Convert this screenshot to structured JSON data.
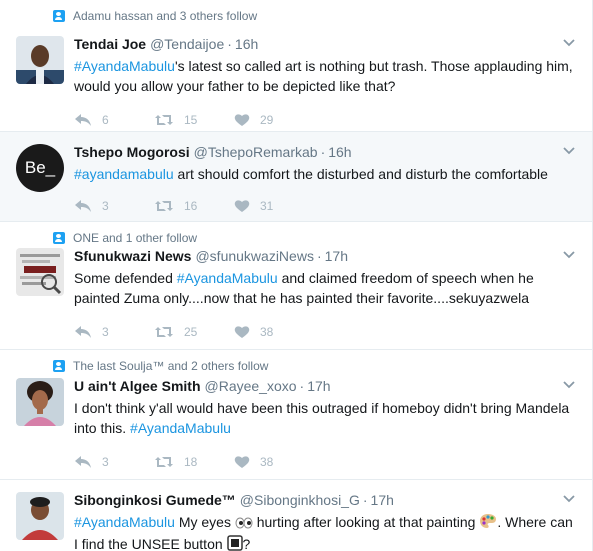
{
  "tweets": [
    {
      "context": "Adamu hassan and 3 others follow",
      "name": "Tendai Joe",
      "handle": "@Tendaijoe",
      "time": "16h",
      "text_pre": "",
      "hashtag": "#AyandaMabulu",
      "text_post": "'s latest so called art is nothing but trash. Those applauding him, would you allow your father to be depicted like that?",
      "replies": "6",
      "retweets": "15",
      "likes": "29"
    },
    {
      "context": "",
      "name": "Tshepo Mogorosi",
      "handle": "@TshepoRemarkab",
      "time": "16h",
      "avatar_text": "Be_",
      "text_pre": "",
      "hashtag": "#ayandamabulu",
      "text_post": " art should comfort the disturbed and disturb the comfortable",
      "replies": "3",
      "retweets": "16",
      "likes": "31"
    },
    {
      "context": "ONE and 1 other follow",
      "name": "Sfunukwazi News",
      "handle": "@sfunukwaziNews",
      "time": "17h",
      "text_pre": "Some defended ",
      "hashtag": "#AyandaMabulu",
      "text_post": " and claimed freedom of speech when he painted Zuma only....now that he has painted their favorite....sekuyazwela",
      "replies": "3",
      "retweets": "25",
      "likes": "38"
    },
    {
      "context": "The last Soulja™ and 2 others follow",
      "name": "U ain't Algee Smith",
      "handle": "@Rayee_xoxo",
      "time": "17h",
      "text_pre": "I don't think y'all would have been  this outraged if homeboy didn't bring Mandela into this. ",
      "hashtag": "#AyandaMabulu",
      "text_post": "",
      "replies": "3",
      "retweets": "18",
      "likes": "38"
    },
    {
      "context": "",
      "name": "Sibonginkosi Gumede™",
      "handle": "@Sibonginkhosi_G",
      "time": "17h",
      "text_pre": "",
      "hashtag": "#AyandaMabulu",
      "text_mid1": " My eyes ",
      "text_mid2": " hurting after looking at that painting ",
      "text_mid3": ". Where can I find the UNSEE button ",
      "text_end": "?"
    }
  ],
  "dot": "·",
  "icons": {
    "reply": "reply-icon",
    "retweet": "retweet-icon",
    "like": "heart-icon",
    "more": "chevron-down-icon"
  },
  "colors": {
    "hashtag": "#1b95e0",
    "context_icon": "#1da1f2",
    "highlight_bg": "#f5f8fa",
    "action": "#aab8c2"
  }
}
